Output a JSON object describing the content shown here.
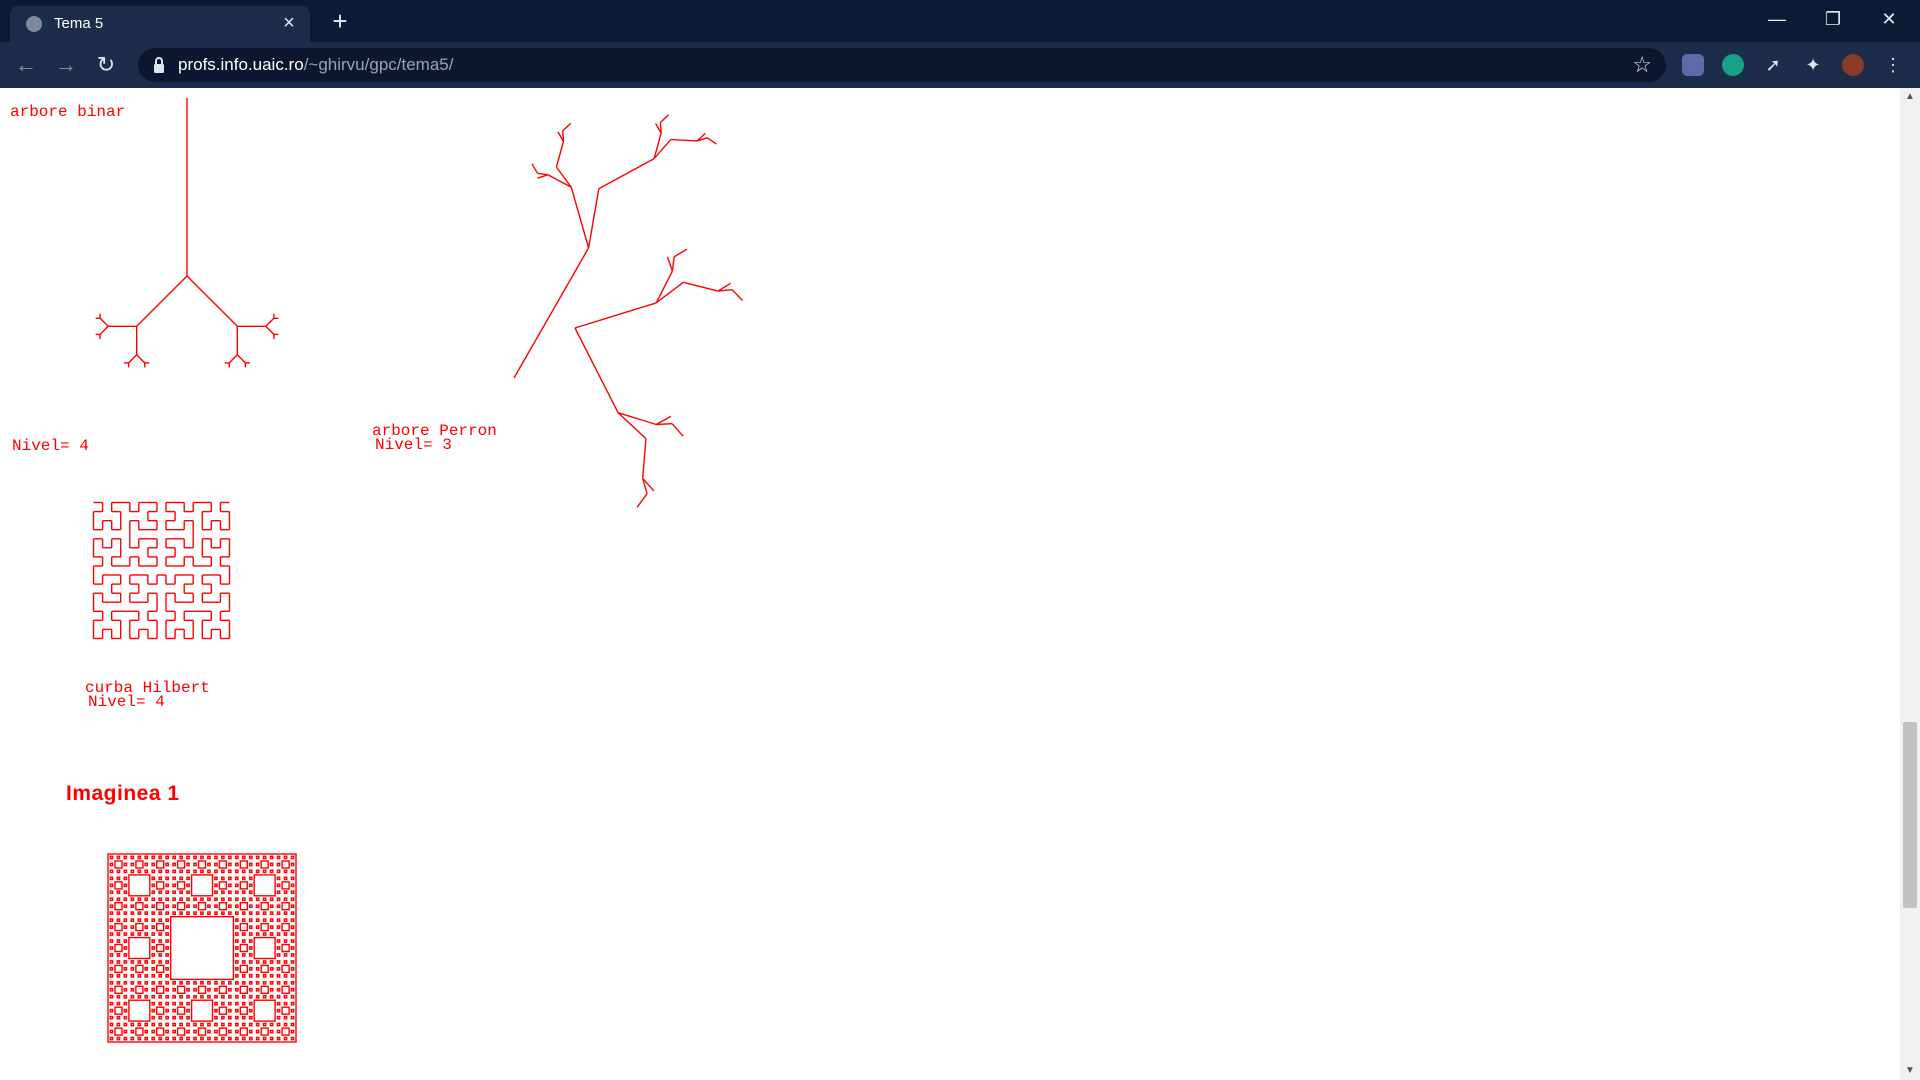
{
  "browser": {
    "tab_title": "Tema 5",
    "url_host": "profs.info.uaic.ro",
    "url_path": "/~ghirvu/gpc/tema5/",
    "icons": {
      "back": "arrow-left-icon",
      "forward": "arrow-right-icon",
      "reload": "reload-icon",
      "star": "star-icon",
      "close": "close-icon",
      "new_tab": "plus-icon"
    }
  },
  "page": {
    "fractal_color": "#ff0000",
    "labels": {
      "binary_title": "arbore binar",
      "binary_level": "Nivel= 4",
      "perron_title": "arbore Perron",
      "perron_level": "Nivel= 3",
      "hilbert_title": "curba Hilbert",
      "hilbert_level": "Nivel= 4"
    },
    "heading": "Imaginea 1"
  }
}
